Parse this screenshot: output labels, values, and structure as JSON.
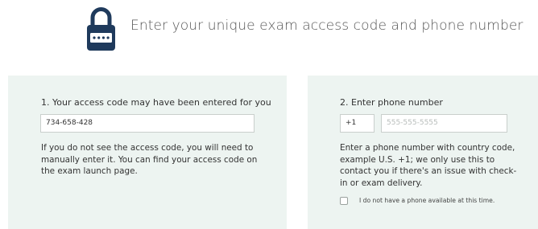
{
  "header": {
    "icon": "lock-icon",
    "title": "Enter your unique exam access code and phone number"
  },
  "access_code_panel": {
    "heading": "1. Your access code may have been entered for you",
    "access_code_value": "734-658-428",
    "help_text": "If you do not see the access code, you will need to manually enter it. You can find your access code on the exam launch page."
  },
  "phone_panel": {
    "heading": "2. Enter phone number",
    "country_code_value": "+1",
    "phone_placeholder": "555-555-5555",
    "help_text": "Enter a phone number with country code, example U.S. +1; we only use this to contact you if there's an issue with check-in or exam delivery.",
    "no_phone_checkbox_label": "I do not have a phone available at this time.",
    "no_phone_checked": false
  },
  "colors": {
    "panel_background": "#edf4f1",
    "lock_body": "#1f3a5c",
    "lock_shackle": "#1f3a5c"
  }
}
